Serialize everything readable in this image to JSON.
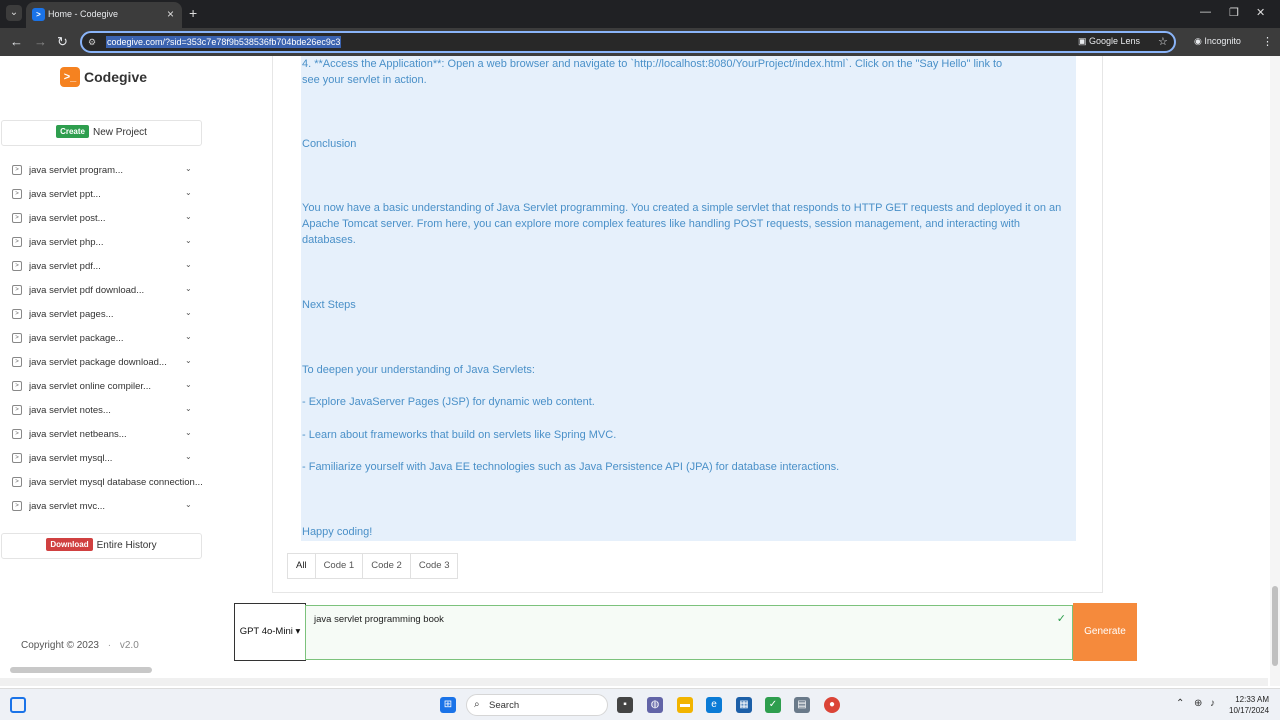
{
  "browser": {
    "tab_title": "Home - Codegive",
    "url": "codegive.com/?sid=353c7e78f9b538536fb704bde26ec9c3",
    "google_lens_label": "Google Lens",
    "incognito_label": "Incognito"
  },
  "sidebar": {
    "logo_text": "Codegive",
    "create_badge": "Create",
    "create_label": "New Project",
    "history": [
      "java servlet program...",
      "java servlet ppt...",
      "java servlet post...",
      "java servlet php...",
      "java servlet pdf...",
      "java servlet pdf download...",
      "java servlet pages...",
      "java servlet package...",
      "java servlet package download...",
      "java servlet online compiler...",
      "java servlet notes...",
      "java servlet netbeans...",
      "java servlet mysql...",
      "java servlet mysql database connection...",
      "java servlet mvc..."
    ],
    "download_badge": "Download",
    "download_label": "Entire History",
    "copyright": "Copyright © 2023",
    "version": "v2.0"
  },
  "content": {
    "step4_line1": "4. **Access the Application**: Open a web browser and navigate to `http://localhost:8080/YourProject/index.html`. Click on the \"Say Hello\" link to",
    "step4_line2": "see your servlet in action.",
    "conclusion_heading": "Conclusion",
    "conclusion_text": "You now have a basic understanding of Java Servlet programming. You created a simple servlet that responds to HTTP GET requests and deployed it on an Apache Tomcat server. From here, you can explore more complex features like handling POST requests, session management, and interacting with databases.",
    "next_steps_heading": "Next Steps",
    "next_steps_intro": "To deepen your understanding of Java Servlets:",
    "bullet1": "- Explore JavaServer Pages (JSP) for dynamic web content.",
    "bullet2": "- Learn about frameworks that build on servlets like Spring MVC.",
    "bullet3": "- Familiarize yourself with Java EE technologies such as Java Persistence API (JPA) for database interactions.",
    "closing": "Happy coding!"
  },
  "code_tabs": [
    "All",
    "Code 1",
    "Code 2",
    "Code 3"
  ],
  "input": {
    "model": "GPT 4o-Mini",
    "prompt": "java servlet programming book",
    "generate_label": "Generate"
  },
  "taskbar": {
    "search_label": "Search",
    "time": "12:33 AM",
    "date": "10/17/2024"
  },
  "colors": {
    "brand_orange": "#f58220",
    "content_text": "#4a90c8",
    "content_bg": "#e6f0fb",
    "create_green": "#2e9e4e",
    "download_red": "#d04040"
  }
}
